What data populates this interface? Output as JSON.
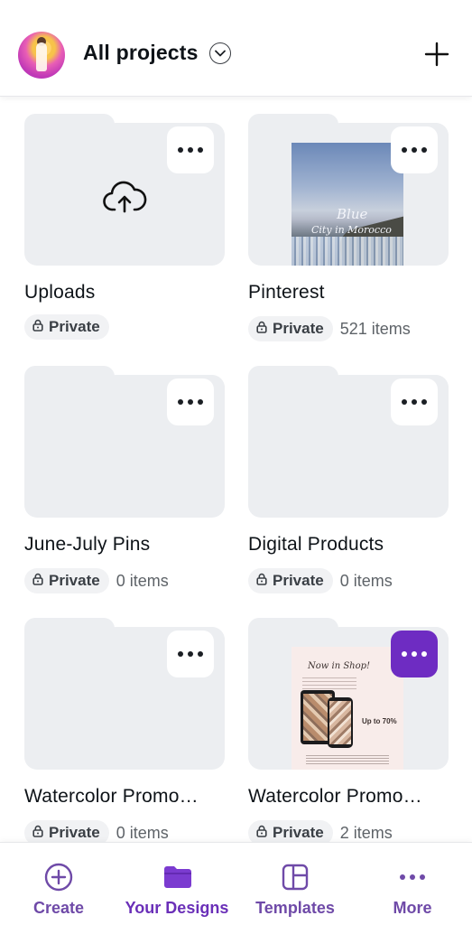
{
  "header": {
    "title": "All projects",
    "icons": {
      "avatar": "user-avatar",
      "chevron": "chevron-down-icon",
      "add": "plus-icon"
    }
  },
  "folders": [
    {
      "name": "Uploads",
      "privacy": "Private",
      "count": "",
      "thumbnail": "upload-cloud-icon"
    },
    {
      "name": "Pinterest",
      "privacy": "Private",
      "count": "521 items",
      "thumbnail": "pin-image",
      "thumb_title": "Blue",
      "thumb_subtitle": "City in Morocco"
    },
    {
      "name": "June-July Pins",
      "privacy": "Private",
      "count": "0 items",
      "thumbnail": ""
    },
    {
      "name": "Digital Products",
      "privacy": "Private",
      "count": "0 items",
      "thumbnail": ""
    },
    {
      "name": "Watercolor Promo…",
      "privacy": "Private",
      "count": "0 items",
      "thumbnail": ""
    },
    {
      "name": "Watercolor Promo…",
      "privacy": "Private",
      "count": "2 items",
      "thumbnail": "shop-image",
      "thumb_title": "Now in Shop!",
      "thumb_sale": "Up to 70%",
      "more_active": true
    }
  ],
  "nav": [
    {
      "label": "Create",
      "icon": "plus-circle-icon"
    },
    {
      "label": "Your Designs",
      "icon": "folder-icon",
      "active": true
    },
    {
      "label": "Templates",
      "icon": "templates-icon"
    },
    {
      "label": "More",
      "icon": "more-horizontal-icon"
    }
  ],
  "colors": {
    "accent": "#6e2cc2",
    "nav_text": "#6f4aa8",
    "folder": "#eceef1",
    "badge_bg": "#f1f2f4"
  }
}
